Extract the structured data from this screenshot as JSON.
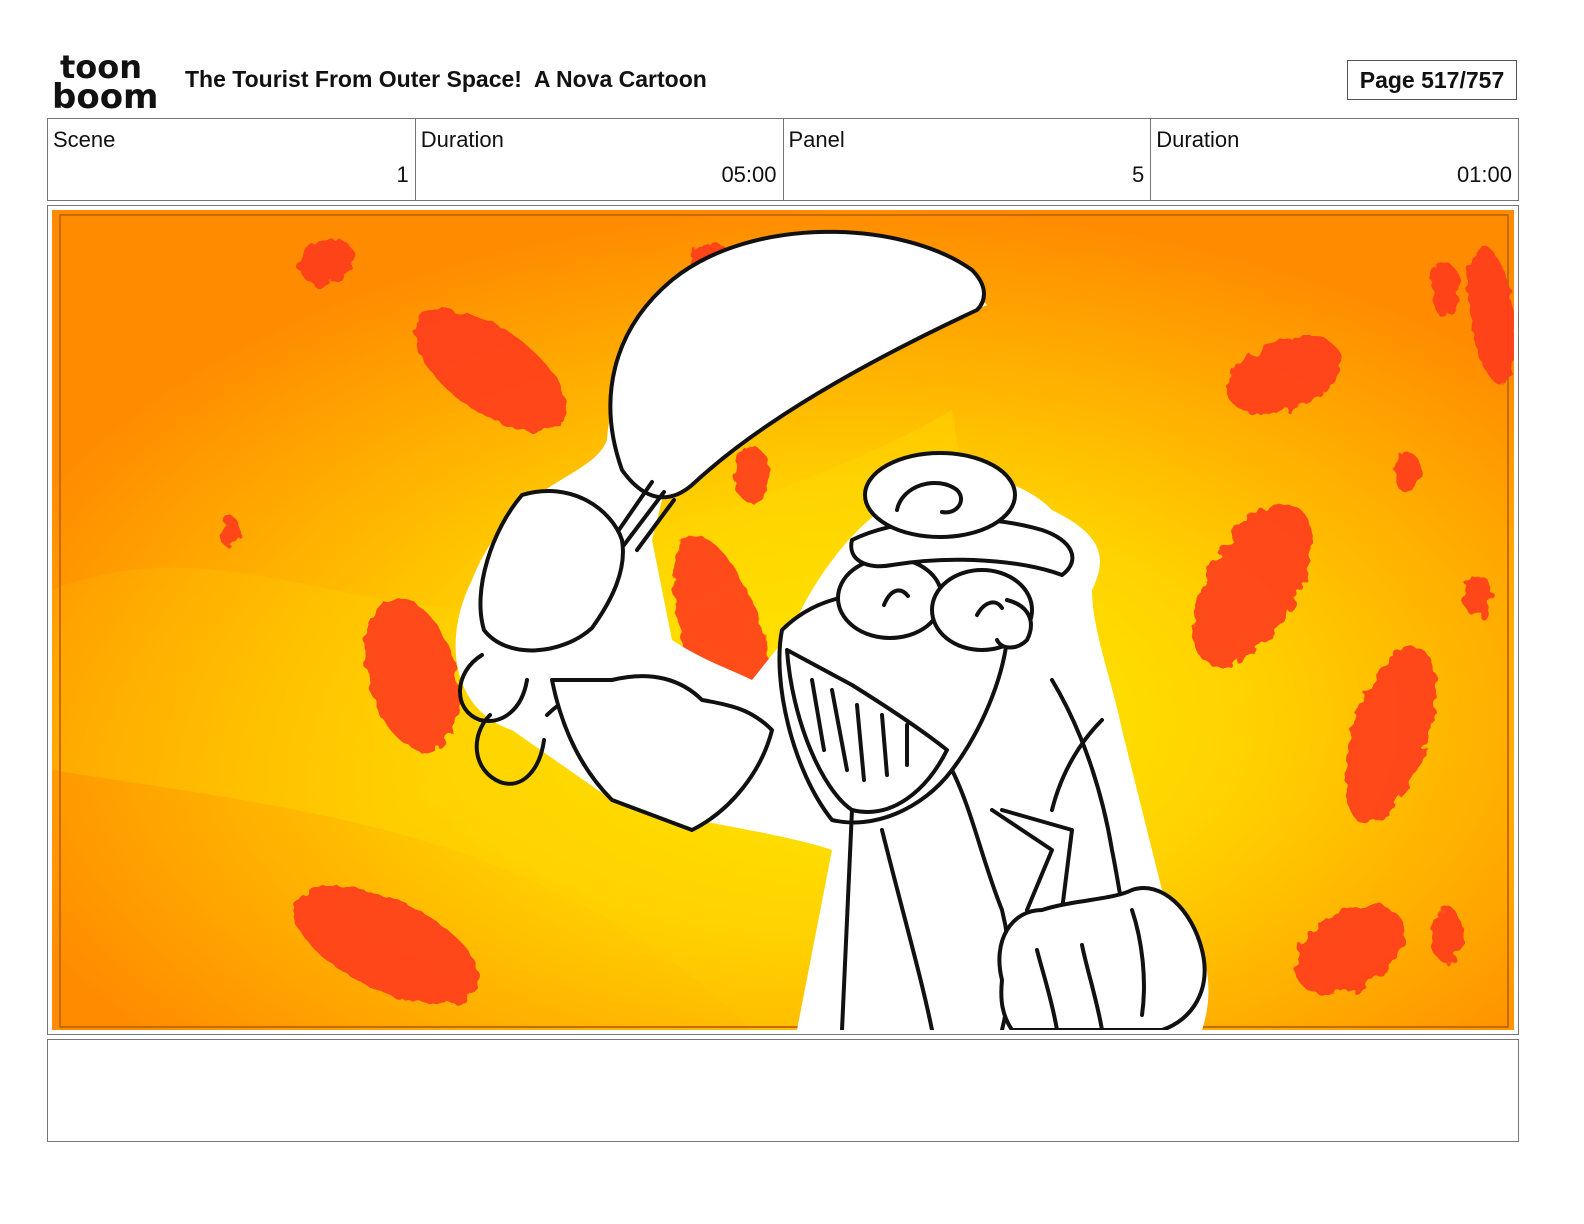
{
  "header": {
    "logo_top": "toon",
    "logo_bottom": "boom",
    "title": "The Tourist From Outer Space!  A Nova Cartoon",
    "page_label": "Page 517/757"
  },
  "info": {
    "scene_label": "Scene",
    "scene_value": "1",
    "scene_duration_label": "Duration",
    "scene_duration_value": "05:00",
    "panel_label": "Panel",
    "panel_value": "5",
    "panel_duration_label": "Duration",
    "panel_duration_value": "01:00"
  },
  "panel": {
    "background_colors": [
      "#ff8c00",
      "#ffb300",
      "#fff200"
    ],
    "splotch_color": "#ff3b1f",
    "line_color": "#111111"
  },
  "caption": {
    "text": ""
  }
}
